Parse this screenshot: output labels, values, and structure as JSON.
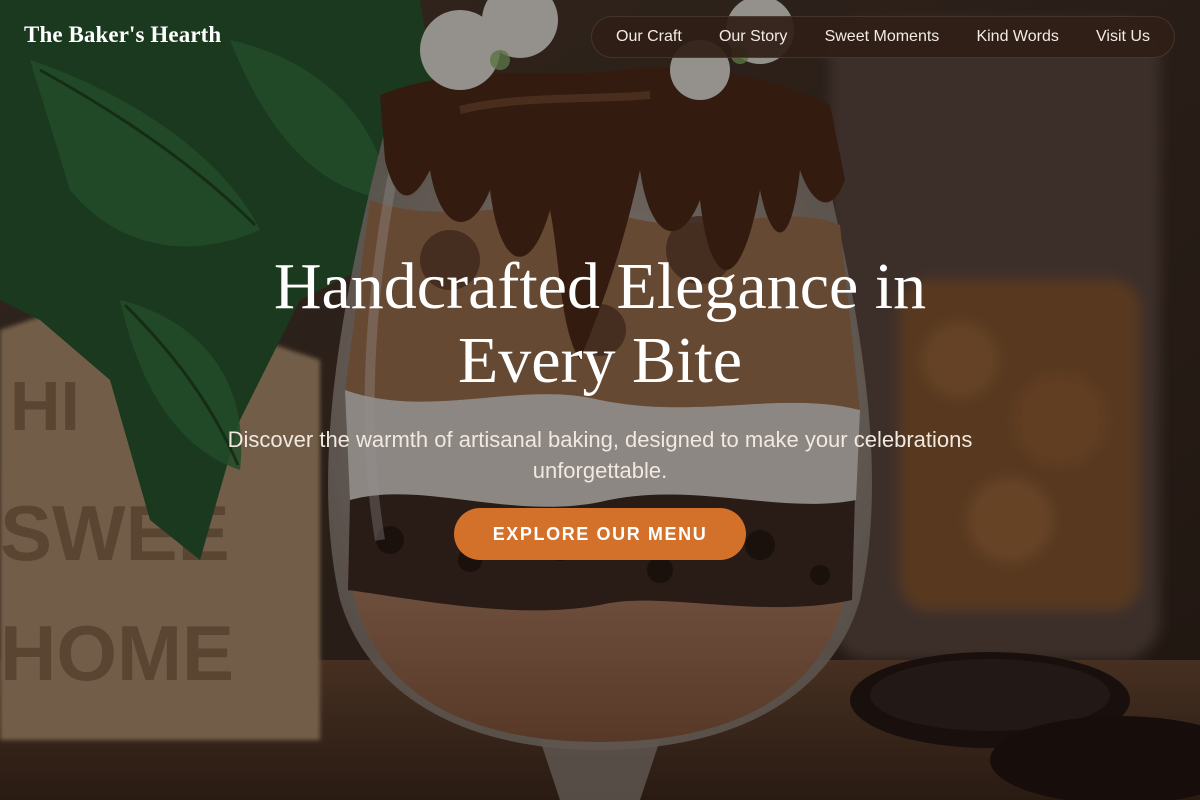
{
  "header": {
    "brand": "The Baker's Hearth",
    "nav": [
      {
        "label": "Our Craft"
      },
      {
        "label": "Our Story"
      },
      {
        "label": "Sweet Moments"
      },
      {
        "label": "Kind Words"
      },
      {
        "label": "Visit Us"
      }
    ]
  },
  "hero": {
    "title": "Handcrafted Elegance in Every Bite",
    "subtitle": "Discover the warmth of artisanal baking, designed to make your celebrations unforgettable.",
    "cta_label": "EXPLORE OUR MENU",
    "background_sign_text": "SWEET HOME"
  },
  "colors": {
    "accent": "#d3712a",
    "nav_bg": "#301e16",
    "text": "#ffffff"
  }
}
